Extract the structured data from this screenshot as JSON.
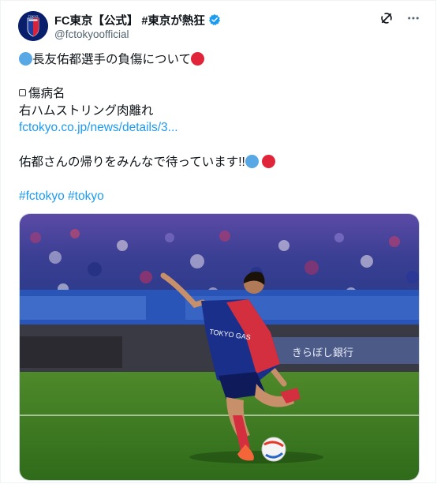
{
  "account": {
    "display_name": "FC東京【公式】 #東京が熱狂",
    "handle": "@fctokyoofficial",
    "avatar_text": "TOKYO"
  },
  "tweet": {
    "line1": "長友佑都選手の負傷について",
    "label": "傷病名",
    "injury": "右ハムストリング肉離れ",
    "link": "fctokyo.co.jp/news/details/3...",
    "message": "佑都さんの帰りをみんなで待っています!!",
    "hashtags": [
      "#fctokyo",
      "#tokyo"
    ]
  },
  "photo": {
    "kit_text": "TOKYO GAS",
    "board_text": "きらぼし銀行"
  },
  "icons": [
    "fc-tokyo-logo-icon",
    "verified-badge-icon",
    "grok-icon",
    "more-icon"
  ],
  "colors": {
    "blue_dot": "#58a8e6",
    "red_dot": "#e0253b",
    "link": "#1d9bf0",
    "verified": "#1d9bf0"
  }
}
